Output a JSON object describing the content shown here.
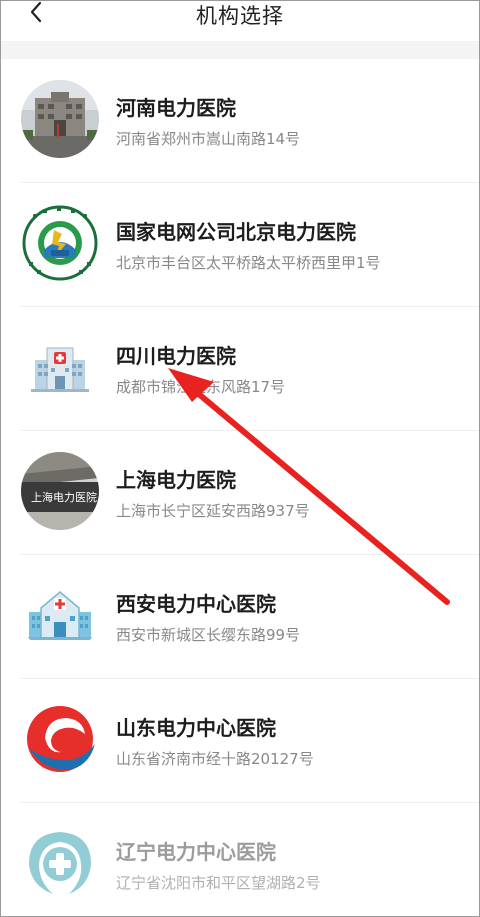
{
  "header": {
    "title": "机构选择",
    "back_icon": "chevron-left-icon"
  },
  "institutions": [
    {
      "name": "河南电力医院",
      "address": "河南省郑州市嵩山南路14号",
      "icon": "hospital-building-photo-icon"
    },
    {
      "name": "国家电网公司北京电力医院",
      "address": "北京市丰台区太平桥路太平桥西里甲1号",
      "icon": "beijing-electric-power-hospital-logo-icon"
    },
    {
      "name": "四川电力医院",
      "address": "成都市锦江区东风路17号",
      "icon": "hospital-building-icon"
    },
    {
      "name": "上海电力医院",
      "address": "上海市长宁区延安西路937号",
      "icon": "shanghai-hospital-sign-photo-icon",
      "sign_text": "上海电力医院"
    },
    {
      "name": "西安电力中心医院",
      "address": "西安市新城区长缨东路99号",
      "icon": "hospital-cross-building-icon"
    },
    {
      "name": "山东电力中心医院",
      "address": "山东省济南市经十路20127号",
      "icon": "red-swirl-logo-icon"
    },
    {
      "name": "辽宁电力中心医院",
      "address": "辽宁省沈阳市和平区望湖路2号",
      "icon": "teal-cross-logo-icon"
    }
  ],
  "annotation": {
    "icon": "red-pointer-arrow-icon",
    "color": "#e8231f"
  },
  "colors": {
    "accent_red": "#e8231f",
    "teal": "#3aa6b5"
  }
}
